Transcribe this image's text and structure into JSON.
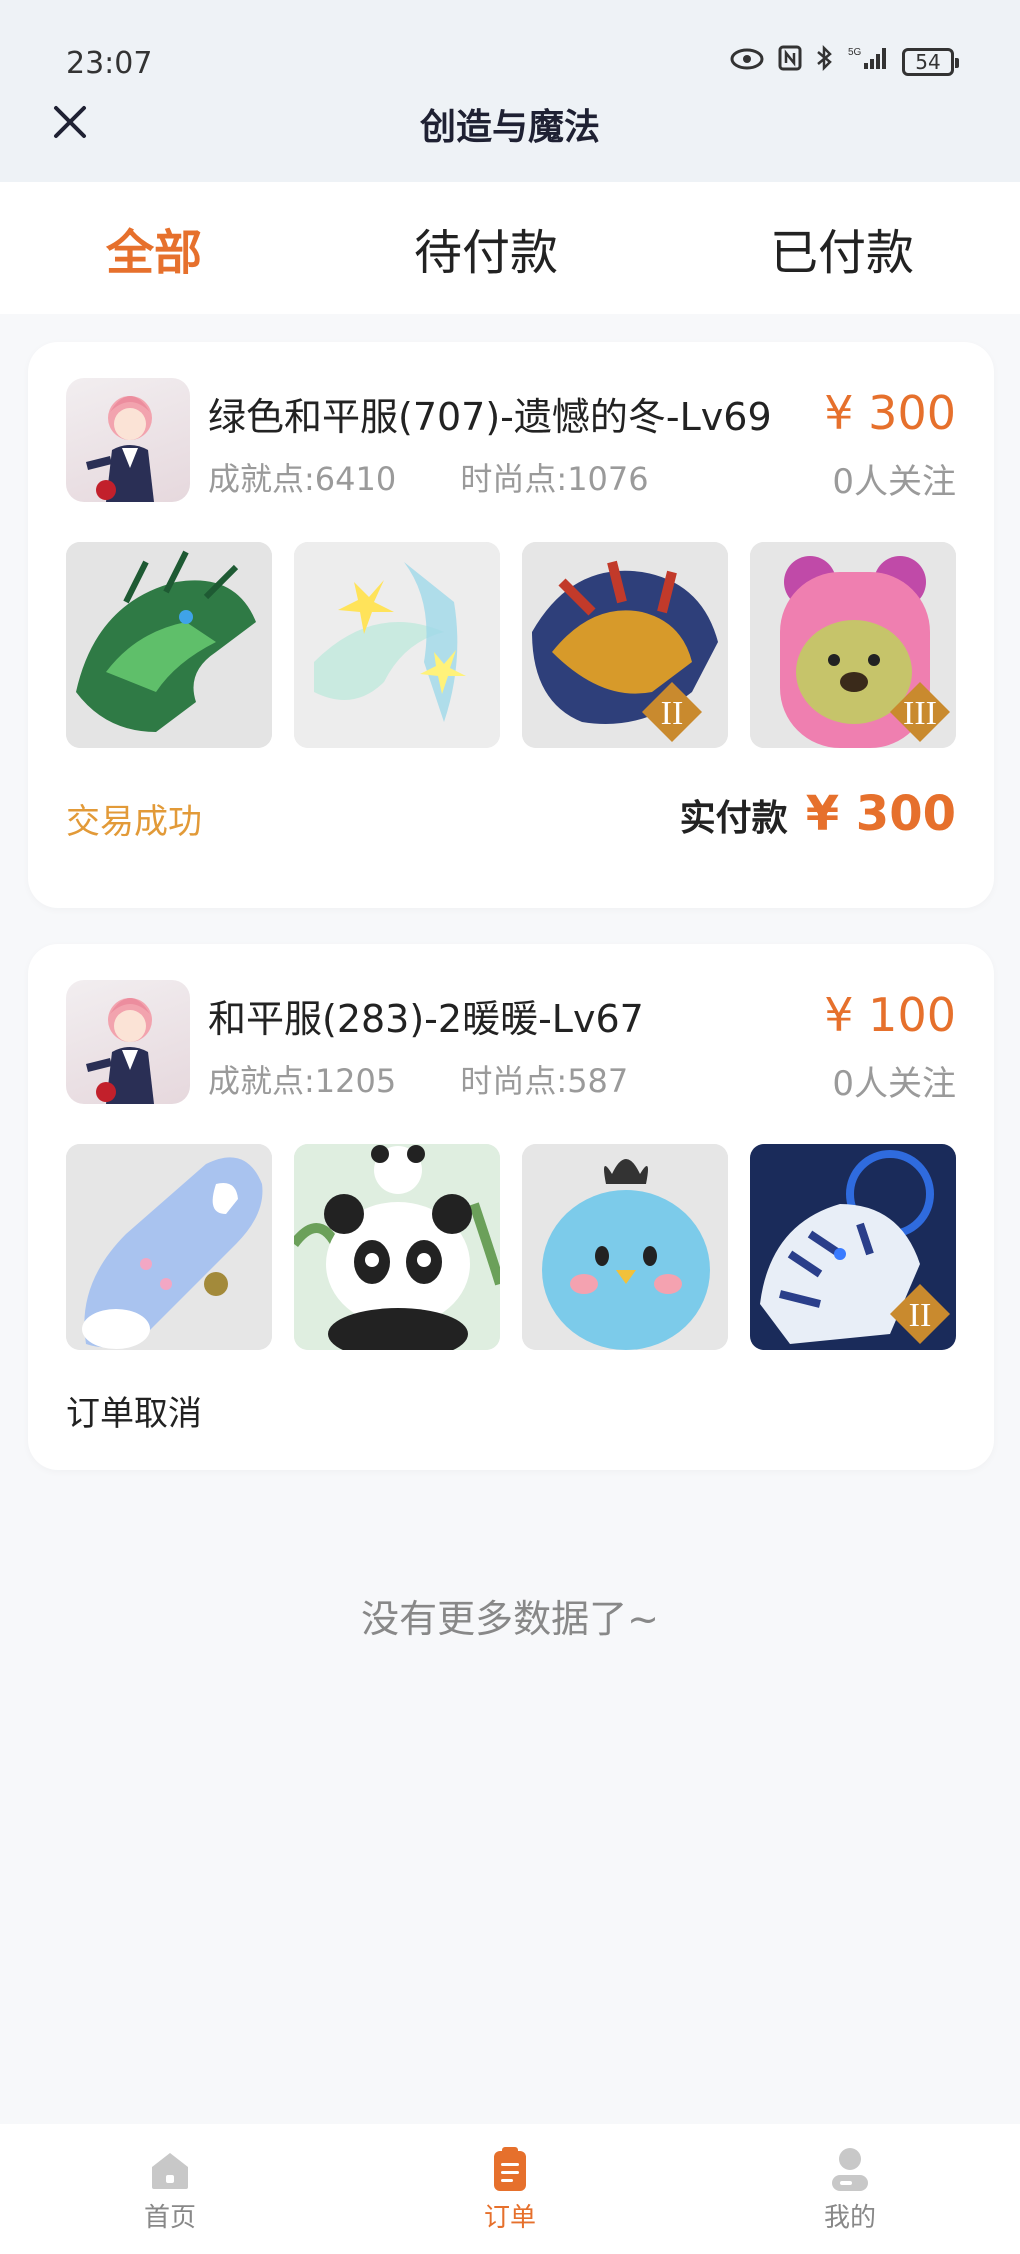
{
  "status_bar": {
    "time": "23:07",
    "battery": "54",
    "network": "5G"
  },
  "header": {
    "title": "创造与魔法",
    "close_icon": "close-icon"
  },
  "tabs": [
    {
      "label": "全部",
      "active": true
    },
    {
      "label": "待付款",
      "active": false
    },
    {
      "label": "已付款",
      "active": false
    }
  ],
  "orders": [
    {
      "title": "绿色和平服(707)-遗憾的冬-Lv69",
      "achievement": "成就点:6410",
      "fashion": "时尚点:1076",
      "price": "¥ 300",
      "followers": "0人关注",
      "thumbnails": [
        "green-dragon-mount",
        "crystal-wings",
        "golden-dragon-mount",
        "pink-bear-hat"
      ],
      "status": "交易成功",
      "paid_label": "实付款",
      "paid_amount": "¥ 300"
    },
    {
      "title": "和平服(283)-2暖暖-Lv67",
      "achievement": "成就点:1205",
      "fashion": "时尚点:587",
      "price": "¥ 100",
      "followers": "0人关注",
      "thumbnails": [
        "blue-skateboard",
        "panda-pet",
        "blue-bird-pet",
        "white-tiger-mount"
      ],
      "status": "订单取消"
    }
  ],
  "footer_text": "没有更多数据了~",
  "bottom_nav": [
    {
      "label": "首页",
      "icon": "home-icon",
      "active": false
    },
    {
      "label": "订单",
      "icon": "order-icon",
      "active": true
    },
    {
      "label": "我的",
      "icon": "user-icon",
      "active": false
    }
  ],
  "colors": {
    "accent": "#e6702c",
    "success": "#e29a38",
    "background": "#f7f8fa"
  }
}
